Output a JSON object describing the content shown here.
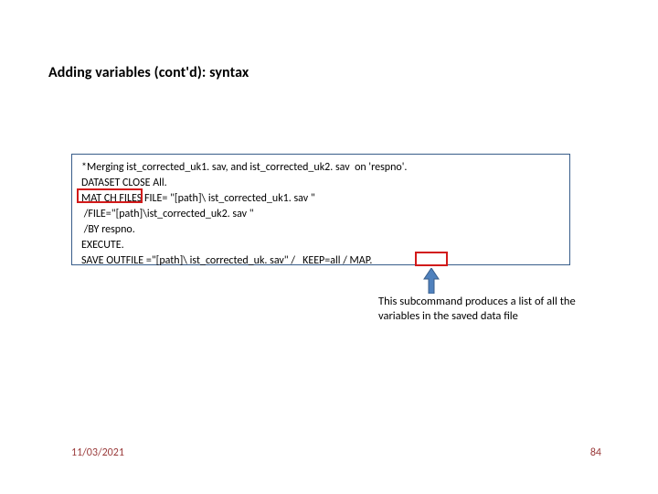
{
  "title": "Adding variables (cont'd): syntax",
  "code": {
    "l1": "*Merging ist_corrected_uk1. sav, and ist_corrected_uk2. sav  on 'respno'.",
    "l2": "DATASET CLOSE All.",
    "l3": "MAT CH FILES FILE= \"[path]\\ ist_corrected_uk1. sav \"",
    "l4": " /FILE=\"[path]\\ist_corrected_uk2. sav \"",
    "l5": " /BY respno.",
    "l6": "EXECUTE.",
    "l7": "SAVE OUTFILE =\"[path]\\ ist_corrected_uk. sav\" /   KEEP=all / MAP."
  },
  "caption": "This subcommand produces a list of all the variables in the saved data file",
  "footer": {
    "date": "11/03/2021",
    "page": "84"
  }
}
